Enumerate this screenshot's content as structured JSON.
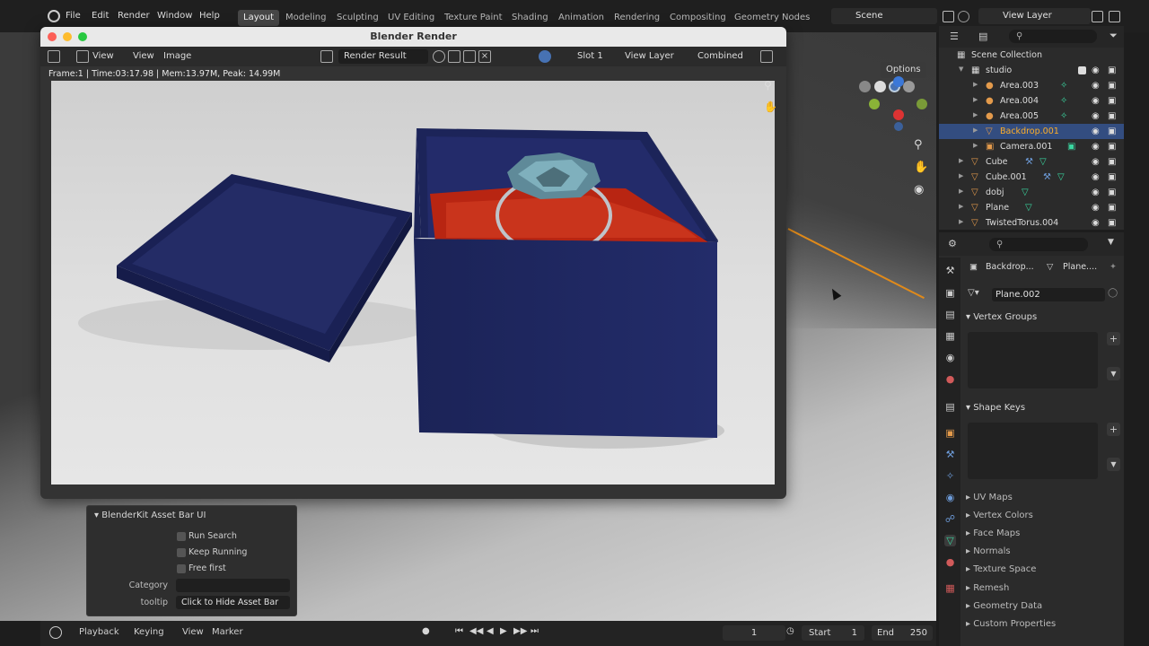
{
  "topbar": {
    "menus": [
      "File",
      "Edit",
      "Render",
      "Window",
      "Help"
    ],
    "workspaces": [
      "Layout",
      "Modeling",
      "Sculpting",
      "UV Editing",
      "Texture Paint",
      "Shading",
      "Animation",
      "Rendering",
      "Compositing",
      "Geometry Nodes"
    ],
    "active_workspace": "Layout",
    "scene": "Scene",
    "view_layer": "View Layer"
  },
  "viewport": {
    "options_label": "Options"
  },
  "render_window": {
    "title": "Blender Render",
    "view_menu": "View",
    "view_label": "View",
    "image_label": "Image",
    "image_name": "Render Result",
    "slot": "Slot 1",
    "view_layer": "View Layer",
    "pass": "Combined",
    "info": "Frame:1 | Time:03:17.98 | Mem:13.97M, Peak: 14.99M"
  },
  "blenderkit": {
    "title": "BlenderKit Asset Bar UI",
    "checks": [
      "Run Search",
      "Keep Running",
      "Free first"
    ],
    "category_label": "Category",
    "category_value": "",
    "tooltip_label": "tooltip",
    "tooltip_value": "Click to Hide Asset Bar"
  },
  "timeline": {
    "playback": "Playback",
    "keying": "Keying",
    "view": "View",
    "marker": "Marker",
    "current_frame": "1",
    "start_label": "Start",
    "start_value": "1",
    "end_label": "End",
    "end_value": "250"
  },
  "outliner": {
    "root": "Scene Collection",
    "rows": [
      {
        "label": "studio",
        "kind": "collection"
      },
      {
        "label": "Area.003",
        "kind": "light"
      },
      {
        "label": "Area.004",
        "kind": "light"
      },
      {
        "label": "Area.005",
        "kind": "light"
      },
      {
        "label": "Backdrop.001",
        "kind": "mesh",
        "selected": true
      },
      {
        "label": "Camera.001",
        "kind": "camera"
      },
      {
        "label": "Cube",
        "kind": "mesh"
      },
      {
        "label": "Cube.001",
        "kind": "mesh"
      },
      {
        "label": "dobj",
        "kind": "mesh"
      },
      {
        "label": "Plane",
        "kind": "mesh"
      },
      {
        "label": "TwistedTorus.004",
        "kind": "mesh"
      }
    ]
  },
  "properties": {
    "object_crumb": "Backdrop...",
    "mesh_crumb": "Plane....",
    "mesh_name": "Plane.002",
    "sections_open": [
      "Vertex Groups",
      "Shape Keys"
    ],
    "sections_closed": [
      "UV Maps",
      "Vertex Colors",
      "Face Maps",
      "Normals",
      "Texture Space",
      "Remesh",
      "Geometry Data",
      "Custom Properties"
    ]
  },
  "colors": {
    "accent_blue": "#4772b3",
    "selection": "#334d80",
    "light_icon": "#e39a4b",
    "mesh_icon": "#3ad7a0",
    "render_bg": "#d9d9d9",
    "box_blue": "#1d2560",
    "cushion_red": "#b82512"
  }
}
